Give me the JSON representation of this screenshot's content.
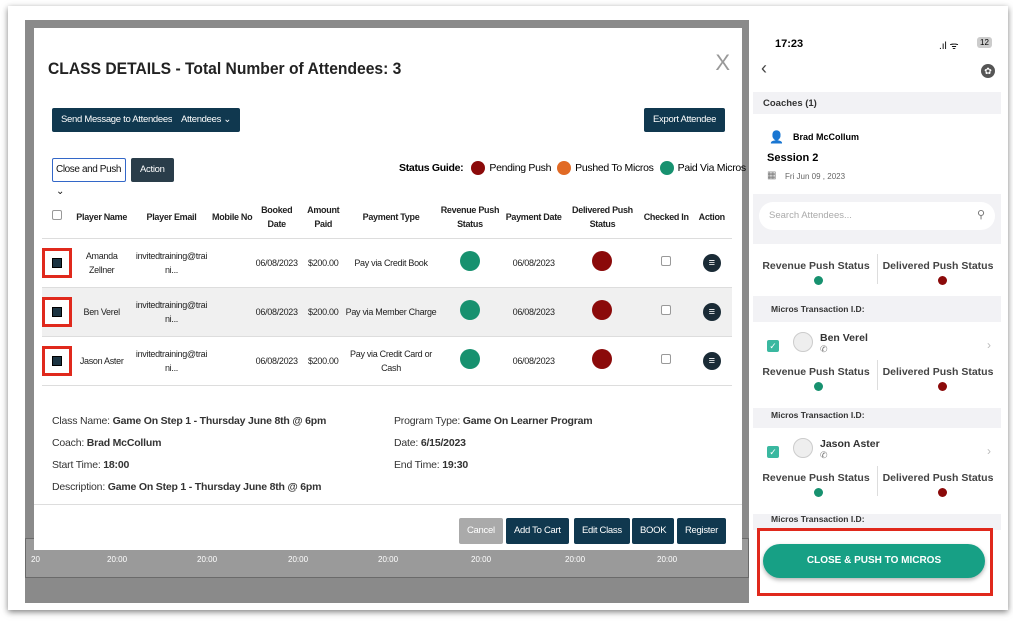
{
  "modal": {
    "title": "CLASS DETAILS - Total Number of Attendees: 3",
    "close": "X",
    "send_message": "Send Message to Attendees",
    "attendees": "Attendees ⌄",
    "export": "Export Attendee",
    "select_value": "Close and Push ⌄",
    "action_btn": "Action",
    "status_guide_label": "Status Guide:",
    "status": {
      "pending": "Pending Push",
      "pushed": "Pushed To Micros",
      "paid": "Paid Via Micros"
    },
    "colors": {
      "pending": "#8b0a0a",
      "pushed": "#e16a25",
      "paid": "#17916f",
      "dark": "#10384f"
    },
    "headers": [
      "Player Name",
      "Player Email",
      "Mobile No",
      "Booked Date",
      "Amount Paid",
      "Payment Type",
      "Revenue Push Status",
      "Payment Date",
      "Delivered Push Status",
      "Checked In",
      "Action"
    ],
    "rows": [
      {
        "name": "Amanda Zellner",
        "email": "invitedtraining@trai ni...",
        "mobile": "",
        "booked": "06/08/2023",
        "amount": "$200.00",
        "ptype": "Pay via Credit Book",
        "pdate": "06/08/2023"
      },
      {
        "name": "Ben Verel",
        "email": "invitedtraining@trai ni...",
        "mobile": "",
        "booked": "06/08/2023",
        "amount": "$200.00",
        "ptype": "Pay via Member Charge",
        "pdate": "06/08/2023"
      },
      {
        "name": "Jason Aster",
        "email": "invitedtraining@trai ni...",
        "mobile": "",
        "booked": "06/08/2023",
        "amount": "$200.00",
        "ptype": "Pay via Credit Card or Cash",
        "pdate": "06/08/2023"
      }
    ],
    "info": {
      "class_name_label": "Class Name:",
      "class_name": "Game On Step 1 - Thursday June 8th @ 6pm",
      "coach_label": "Coach:",
      "coach": "Brad McCollum",
      "start_label": "Start Time:",
      "start": "18:00",
      "desc_label": "Description:",
      "desc": "Game On Step 1 - Thursday June 8th @ 6pm",
      "ptype_label": "Program Type:",
      "ptype": "Game On Learner Program",
      "date_label": "Date:",
      "date": "6/15/2023",
      "end_label": "End Time:",
      "end": "19:30"
    },
    "footer": {
      "cancel": "Cancel",
      "add_cart": "Add To Cart",
      "edit": "Edit Class",
      "book": "BOOK",
      "register": "Register"
    }
  },
  "background": {
    "row_num": "20",
    "times": [
      "20:00",
      "20:00",
      "20:00",
      "20:00",
      "20:00",
      "20:00",
      "20:00"
    ]
  },
  "phone": {
    "time": "17:23",
    "battery": "12",
    "coaches": "Coaches (1)",
    "coach": "Brad McCollum",
    "session": "Session 2",
    "date": "Fri Jun 09 , 2023",
    "search_placeholder": "Search Attendees...",
    "revenue": "Revenue Push Status",
    "delivered": "Delivered Push Status",
    "micros": "Micros Transaction I.D:",
    "attendees": [
      "Ben Verel",
      "Jason Aster"
    ],
    "cta": "CLOSE & PUSH TO MICROS"
  }
}
